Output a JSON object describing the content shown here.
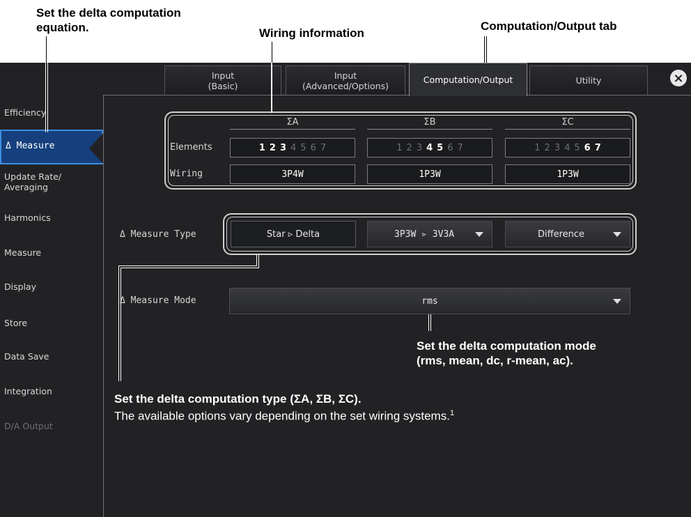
{
  "callouts": {
    "equation_line1": "Set the delta computation",
    "equation_line2": "equation.",
    "wiring_info": "Wiring information",
    "tab_info": "Computation/Output tab",
    "mode_line1": "Set the delta computation mode",
    "mode_line2": "(rms, mean, dc, r-mean, ac).",
    "type_bold": "Set the delta computation type (ΣA, ΣB, ΣC).",
    "type_plain": "The available options vary depending on the set wiring systems.",
    "type_sup": "1"
  },
  "tabs": [
    {
      "label_line1": "Input",
      "label_line2": "(Basic)"
    },
    {
      "label_line1": "Input",
      "label_line2": "(Advanced/Options)"
    },
    {
      "label_line1": "Computation/Output",
      "label_line2": ""
    },
    {
      "label_line1": "Utility",
      "label_line2": ""
    }
  ],
  "active_tab": "Computation/Output",
  "close_icon": "×",
  "sidebar": {
    "items": [
      {
        "label": "Efficiency"
      },
      {
        "label": "Δ Measure"
      },
      {
        "label_line1": "Update Rate/",
        "label_line2": "Averaging"
      },
      {
        "label": "Harmonics"
      },
      {
        "label": "Measure"
      },
      {
        "label": "Display"
      },
      {
        "label": "Store"
      },
      {
        "label": "Data Save"
      },
      {
        "label": "Integration"
      },
      {
        "label": "D/A Output"
      }
    ],
    "active": "Δ Measure"
  },
  "wiring_table": {
    "groups": [
      "ΣA",
      "ΣB",
      "ΣC"
    ],
    "row_elements_label": "Elements",
    "row_wiring_label": "Wiring",
    "elements": [
      {
        "digits": [
          "1",
          "2",
          "3",
          "4",
          "5",
          "6",
          "7"
        ],
        "active": [
          true,
          true,
          true,
          false,
          false,
          false,
          false
        ]
      },
      {
        "digits": [
          "1",
          "2",
          "3",
          "4",
          "5",
          "6",
          "7"
        ],
        "active": [
          false,
          false,
          false,
          true,
          true,
          false,
          false
        ]
      },
      {
        "digits": [
          "1",
          "2",
          "3",
          "4",
          "5",
          "6",
          "7"
        ],
        "active": [
          false,
          false,
          false,
          false,
          false,
          true,
          true
        ]
      }
    ],
    "wiring": [
      "3P4W",
      "1P3W",
      "1P3W"
    ]
  },
  "measure_type": {
    "label": "Δ Measure Type",
    "star_delta": "Star ▹ Delta",
    "conversion": "3P3W ▹ 3V3A",
    "diff": "Difference"
  },
  "measure_mode": {
    "label": "Δ Measure Mode",
    "value": "rms"
  },
  "colors": {
    "screen_bg": "#222225",
    "active_side": "#15407d",
    "active_side_border": "#3d8de0"
  }
}
